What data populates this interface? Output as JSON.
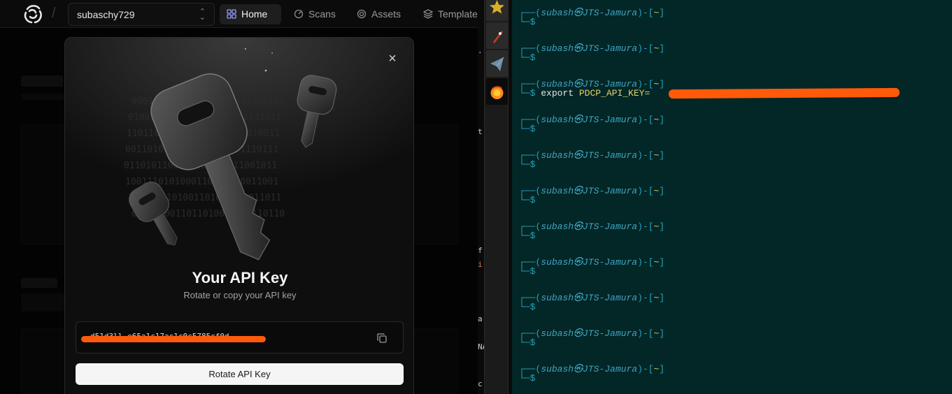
{
  "app": {
    "org": "subaschy729",
    "nav": {
      "home": "Home",
      "scans": "Scans",
      "assets": "Assets",
      "templates": "Template"
    },
    "modal": {
      "title": "Your API Key",
      "subtitle": "Rotate or copy your API key",
      "key_value": "d51d3ll  e65a1c17ac1c0c5785cf0d",
      "rotate_label": "Rotate API Key",
      "close_glyph": "×"
    }
  },
  "strip": {
    "fragments": [
      ".",
      "t",
      "f",
      "i",
      "a",
      "NA",
      "c"
    ]
  },
  "terminal": {
    "prompt_user": "subash",
    "prompt_host": "JTS-Jamura",
    "prompt_dir": "~",
    "blocks": [
      {
        "command": "",
        "value": ""
      },
      {
        "command": "",
        "value": ""
      },
      {
        "command": "export",
        "value": "PDCP_API_KEY="
      },
      {
        "command": "",
        "value": ""
      },
      {
        "command": "",
        "value": ""
      },
      {
        "command": "",
        "value": ""
      },
      {
        "command": "",
        "value": ""
      },
      {
        "command": "",
        "value": ""
      },
      {
        "command": "",
        "value": ""
      },
      {
        "command": "",
        "value": ""
      },
      {
        "command": "",
        "value": ""
      }
    ]
  },
  "colors": {
    "terminal_bg": "#032626",
    "prompt_frame": "#2aa0b8",
    "prompt_dir": "#e0d26a",
    "redaction": "#ff5a0a"
  },
  "icons": [
    "logo-icon",
    "home-grid-icon",
    "scans-icon",
    "assets-icon",
    "templates-icon",
    "close-icon",
    "copy-icon",
    "star-icon",
    "rocket-icon",
    "telegram-icon",
    "firefox-icon"
  ]
}
